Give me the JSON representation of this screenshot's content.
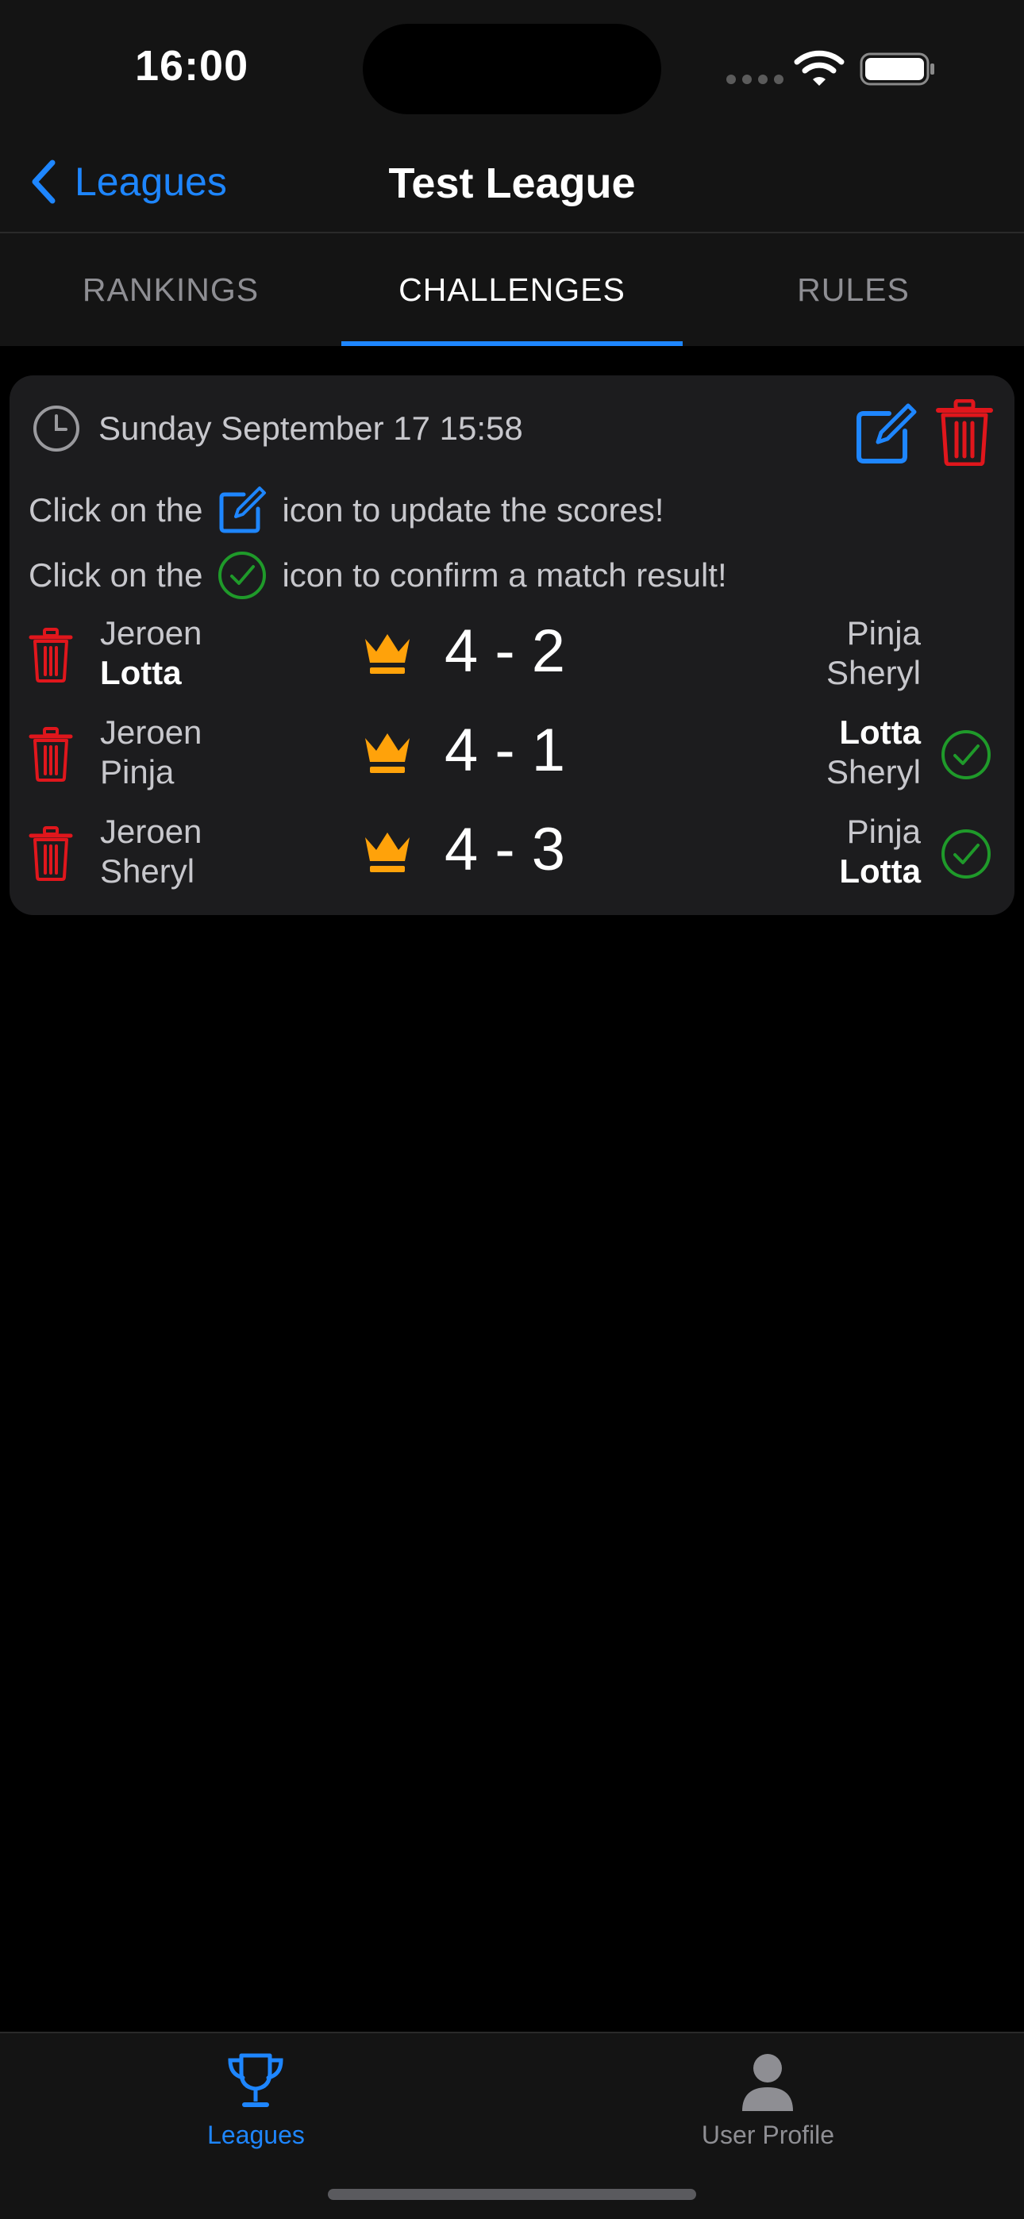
{
  "status_bar": {
    "time": "16:00"
  },
  "nav": {
    "back_label": "Leagues",
    "title": "Test League"
  },
  "tabs": [
    {
      "label": "RANKINGS",
      "active": false
    },
    {
      "label": "CHALLENGES",
      "active": true
    },
    {
      "label": "RULES",
      "active": false
    }
  ],
  "challenge": {
    "date": "Sunday September 17 15:58",
    "info_update": {
      "before": "Click on the",
      "after": "icon to update the scores!",
      "icon": "edit-icon"
    },
    "info_confirm": {
      "before": "Click on the",
      "after": "icon to confirm a match result!",
      "icon": "checkmark-circle-icon"
    },
    "matches": [
      {
        "left": [
          {
            "name": "Jeroen",
            "winner": false
          },
          {
            "name": "Lotta",
            "winner": true
          }
        ],
        "score": "4 - 2",
        "right": [
          {
            "name": "Pinja",
            "winner": false
          },
          {
            "name": "Sheryl",
            "winner": false
          }
        ],
        "confirmable": false
      },
      {
        "left": [
          {
            "name": "Jeroen",
            "winner": false
          },
          {
            "name": "Pinja",
            "winner": false
          }
        ],
        "score": "4 - 1",
        "right": [
          {
            "name": "Lotta",
            "winner": true
          },
          {
            "name": "Sheryl",
            "winner": false
          }
        ],
        "confirmable": true
      },
      {
        "left": [
          {
            "name": "Jeroen",
            "winner": false
          },
          {
            "name": "Sheryl",
            "winner": false
          }
        ],
        "score": "4 - 3",
        "right": [
          {
            "name": "Pinja",
            "winner": false
          },
          {
            "name": "Lotta",
            "winner": true
          }
        ],
        "confirmable": true
      }
    ]
  },
  "tab_bar": {
    "items": [
      {
        "label": "Leagues",
        "icon": "trophy-icon",
        "active": true
      },
      {
        "label": "User Profile",
        "icon": "person-icon",
        "active": false
      }
    ]
  },
  "colors": {
    "accent": "#1e86ff",
    "delete": "#e0161c",
    "confirm": "#1f9a2a",
    "crown": "#ffa20a",
    "card": "#1c1c1e",
    "inactive": "#8e8e93"
  }
}
